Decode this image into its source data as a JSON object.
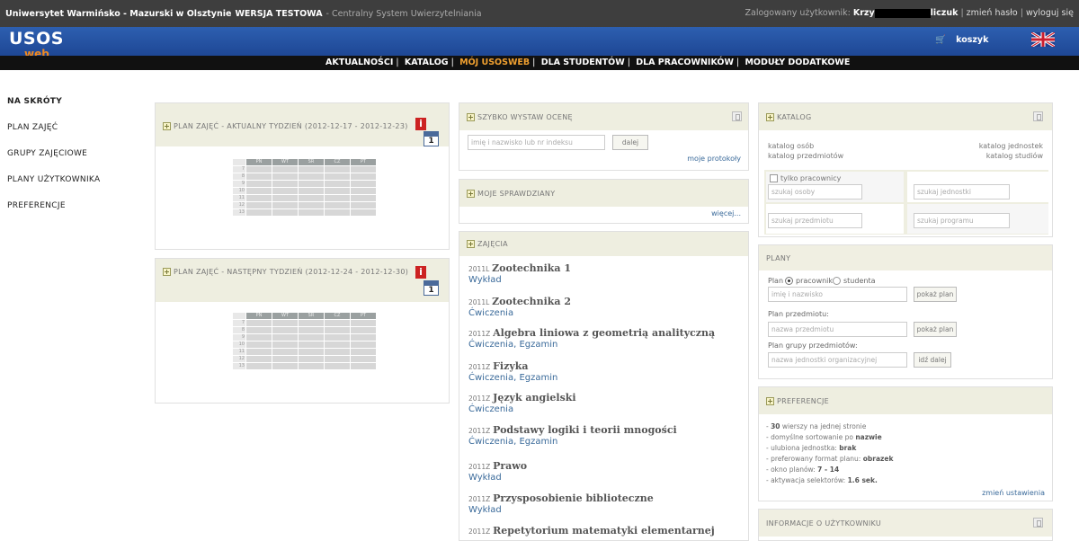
{
  "topbar": {
    "university": "Uniwersytet Warmińsko - Mazurski w Olsztynie",
    "version": "WERSJA TESTOWA",
    "system": "- Centralny System Uwierzytelniania",
    "logged_label": "Zalogowany użytkownik:",
    "user_prefix": "Krzy",
    "user_suffix": "liczuk",
    "change_password": "zmień hasło",
    "logout": "wyloguj się"
  },
  "header": {
    "logo": "USOS",
    "logo_sub": "web",
    "cart": "koszyk"
  },
  "nav": {
    "items": [
      "AKTUALNOŚCI",
      "KATALOG",
      "MÓJ USOSWEB",
      "DLA STUDENTÓW",
      "DLA PRACOWNIKÓW",
      "MODUŁY DODATKOWE"
    ]
  },
  "sidebar": {
    "items": [
      "NA SKRÓTY",
      "PLAN ZAJĘĆ",
      "GRUPY ZAJĘCIOWE",
      "PLANY UŻYTKOWNIKA",
      "PREFERENCJE"
    ]
  },
  "plan_current": {
    "title": "PLAN ZAJĘĆ - AKTUALNY TYDZIEŃ (2012-12-17 - 2012-12-23)",
    "days": [
      "PN",
      "WT",
      "ŚR",
      "CZ",
      "PT"
    ],
    "hours": [
      "7",
      "8",
      "9",
      "10",
      "11",
      "12",
      "13"
    ]
  },
  "plan_next": {
    "title": "PLAN ZAJĘĆ - NASTĘPNY TYDZIEŃ (2012-12-24 - 2012-12-30)",
    "days": [
      "PN",
      "WT",
      "ŚR",
      "CZ",
      "PT"
    ],
    "hours": [
      "7",
      "8",
      "9",
      "10",
      "11",
      "12",
      "13"
    ]
  },
  "grade": {
    "title": "SZYBKO WYSTAW OCENĘ",
    "placeholder": "imię i nazwisko lub nr indeksu",
    "button": "dalej",
    "link": "moje protokoły"
  },
  "tests": {
    "title": "MOJE SPRAWDZIANY",
    "link": "więcej..."
  },
  "classes": {
    "title": "ZAJĘCIA",
    "items": [
      {
        "term": "2011L",
        "name": "Zootechnika 1",
        "types": "Wykład"
      },
      {
        "term": "2011L",
        "name": "Zootechnika 2",
        "types": "Ćwiczenia"
      },
      {
        "term": "2011Z",
        "name": "Algebra liniowa z geometrią analityczną",
        "types": "Ćwiczenia, Egzamin"
      },
      {
        "term": "2011Z",
        "name": "Fizyka",
        "types": "Ćwiczenia, Egzamin"
      },
      {
        "term": "2011Z",
        "name": "Język angielski",
        "types": "Ćwiczenia"
      },
      {
        "term": "2011Z",
        "name": "Podstawy logiki i teorii mnogości",
        "types": "Ćwiczenia, Egzamin"
      },
      {
        "term": "2011Z",
        "name": "Prawo",
        "types": "Wykład"
      },
      {
        "term": "2011Z",
        "name": "Przysposobienie biblioteczne",
        "types": "Wykład"
      },
      {
        "term": "2011Z",
        "name": "Repetytorium matematyki elementarnej",
        "types": ""
      }
    ]
  },
  "catalog": {
    "title": "KATALOG",
    "links_left": [
      "katalog osób",
      "katalog przedmiotów"
    ],
    "links_right": [
      "katalog jednostek",
      "katalog studiów"
    ],
    "only_staff": "tylko pracownicy",
    "search_person": "szukaj osoby",
    "search_unit": "szukaj jednostki",
    "search_course": "szukaj przedmiotu",
    "search_program": "szukaj programu"
  },
  "plans": {
    "title": "PLANY",
    "plan_label": "Plan",
    "radio_staff": "pracownika",
    "radio_student": "studenta",
    "name_placeholder": "imię i nazwisko",
    "show_plan": "pokaż plan",
    "course_plan_label": "Plan przedmiotu:",
    "course_placeholder": "nazwa przedmiotu",
    "group_plan_label": "Plan grupy przedmiotów:",
    "group_placeholder": "nazwa jednostki organizacyjnej",
    "go_button": "idź dalej"
  },
  "preferences": {
    "title": "PREFERENCJE",
    "lines": [
      {
        "pre": "- ",
        "bold": "30",
        "post": " wierszy na jednej stronie"
      },
      {
        "pre": "- domyślne sortowanie po ",
        "bold": "nazwie",
        "post": ""
      },
      {
        "pre": "- ulubiona jednostka: ",
        "bold": "brak",
        "post": ""
      },
      {
        "pre": "- preferowany format planu: ",
        "bold": "obrazek",
        "post": ""
      },
      {
        "pre": "- okno planów: ",
        "bold": "7 - 14",
        "post": ""
      },
      {
        "pre": "- aktywacja selektorów: ",
        "bold": "1.6 sek.",
        "post": ""
      }
    ],
    "link": "zmień ustawienia"
  },
  "userinfo": {
    "title": "INFORMACJE O UŻYTKOWNIKU"
  },
  "colors": {
    "header_blue": "#1e4795",
    "nav_active": "#f0a030",
    "link": "#3a6a9a"
  }
}
